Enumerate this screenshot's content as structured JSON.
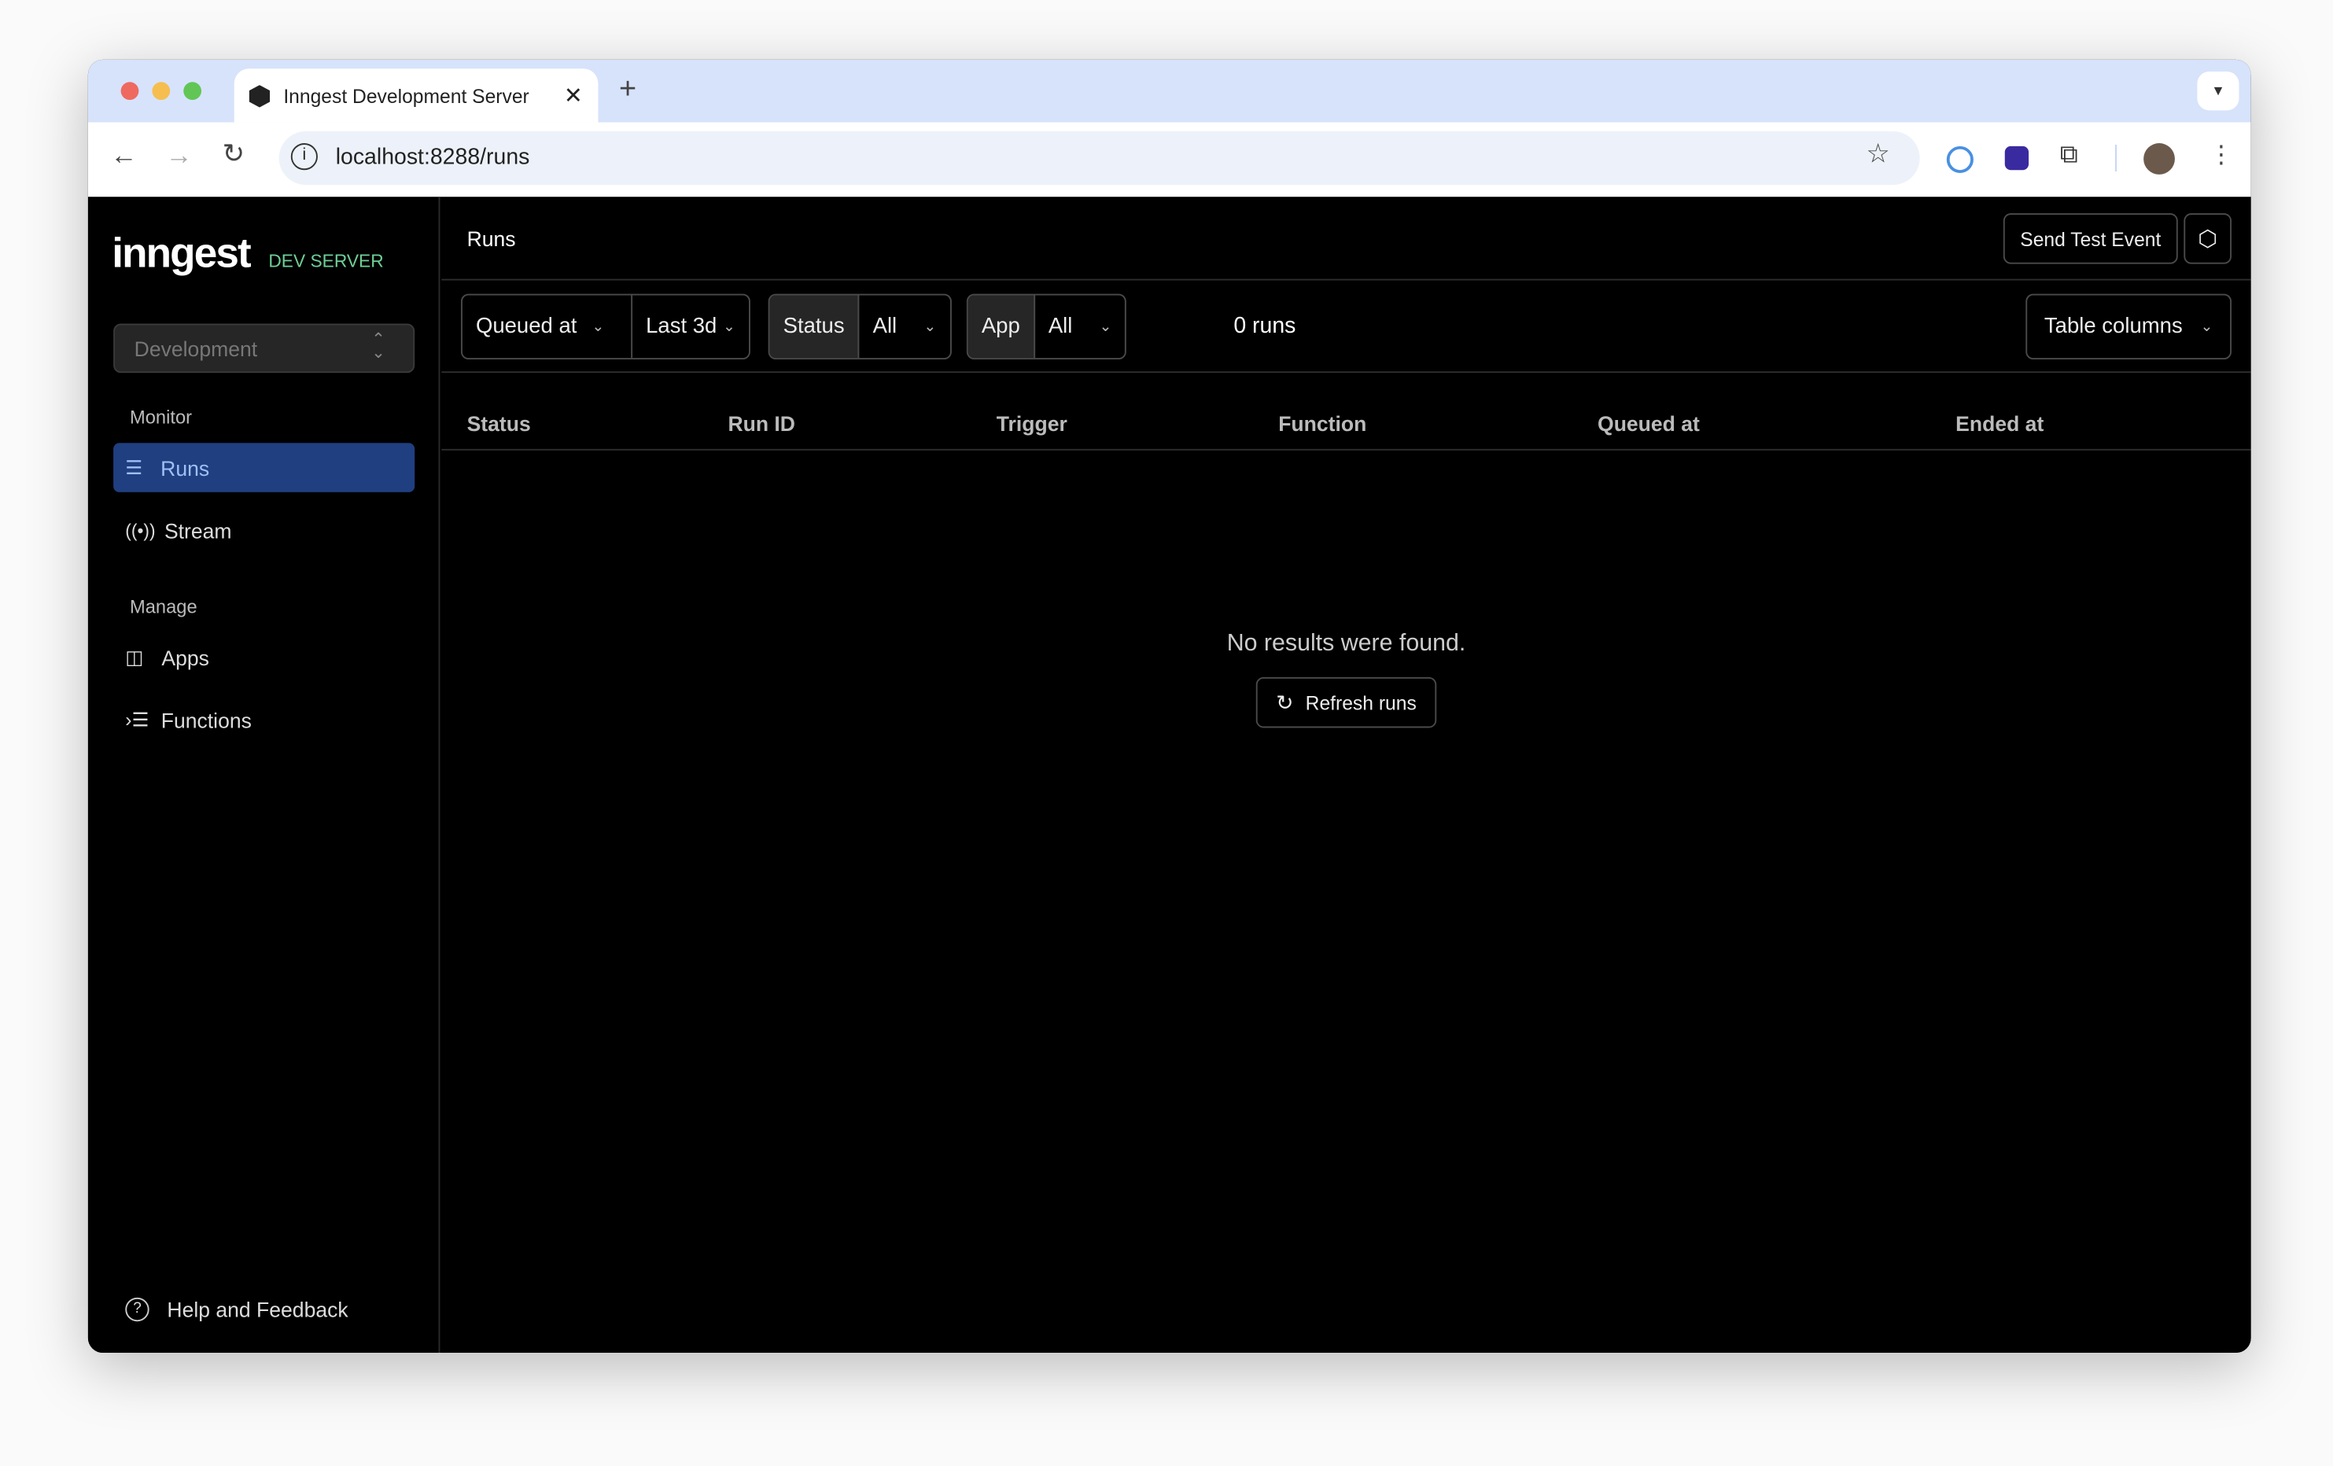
{
  "browser": {
    "tab_title": "Inngest Development Server",
    "url": "localhost:8288/runs"
  },
  "sidebar": {
    "logo": "inngest",
    "badge": "DEV SERVER",
    "env_select": "Development",
    "sections": [
      {
        "label": "Monitor",
        "items": [
          {
            "label": "Runs",
            "icon": "runs-icon",
            "active": true
          },
          {
            "label": "Stream",
            "icon": "broadcast-icon"
          }
        ]
      },
      {
        "label": "Manage",
        "items": [
          {
            "label": "Apps",
            "icon": "apps-icon"
          },
          {
            "label": "Functions",
            "icon": "functions-icon"
          }
        ]
      }
    ],
    "help": "Help and Feedback"
  },
  "header": {
    "title": "Runs",
    "send_test_event": "Send Test Event"
  },
  "filters": {
    "time_field": "Queued at",
    "time_range": "Last 3d",
    "status_label": "Status",
    "status_value": "All",
    "app_label": "App",
    "app_value": "All",
    "count": "0 runs",
    "table_columns": "Table columns"
  },
  "table": {
    "columns": [
      "Status",
      "Run ID",
      "Trigger",
      "Function",
      "Queued at",
      "Ended at"
    ]
  },
  "empty": {
    "message": "No results were found.",
    "refresh": "Refresh runs"
  },
  "colors": {
    "accent": "#203f80",
    "accent_text": "#9ec0f6",
    "badge": "#6fcf97"
  }
}
